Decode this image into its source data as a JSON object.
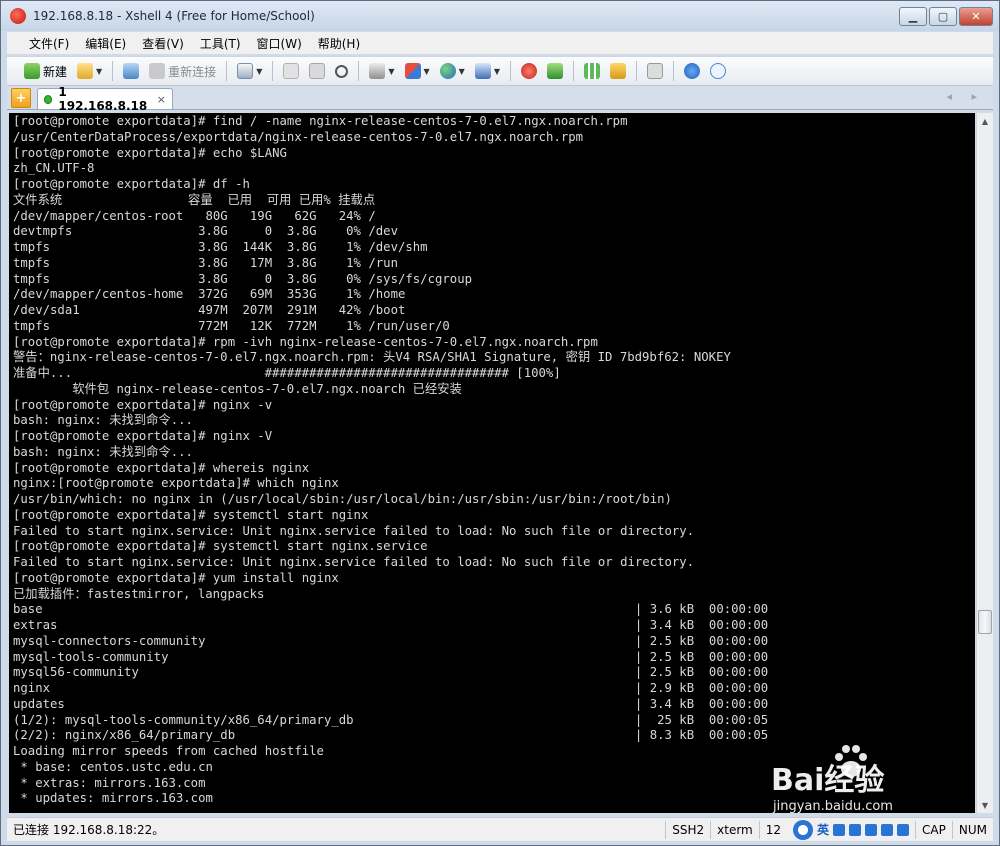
{
  "window": {
    "title": "192.168.8.18 - Xshell 4 (Free for Home/School)"
  },
  "window_controls": {
    "minimize": "▁",
    "maximize": "▢",
    "close": "✕"
  },
  "menu": [
    "文件(F)",
    "编辑(E)",
    "查看(V)",
    "工具(T)",
    "窗口(W)",
    "帮助(H)"
  ],
  "toolbar": {
    "new_label": "新建",
    "reconnect_label": "重新连接"
  },
  "tab": {
    "label": "1 192.168.8.18",
    "close": "×",
    "nav": "◂ ▸"
  },
  "colors": {
    "terminal_bg": "#000000",
    "terminal_fg": "#d8d8d8",
    "tab_dot": "#2fb52f"
  },
  "terminal": {
    "lines": [
      "[root@promote exportdata]# find / -name nginx-release-centos-7-0.el7.ngx.noarch.rpm",
      "/usr/CenterDataProcess/exportdata/nginx-release-centos-7-0.el7.ngx.noarch.rpm",
      "[root@promote exportdata]# echo $LANG",
      "zh_CN.UTF-8",
      "[root@promote exportdata]# df -h",
      "文件系统                 容量  已用  可用 已用% 挂载点",
      "/dev/mapper/centos-root   80G   19G   62G   24% /",
      "devtmpfs                 3.8G     0  3.8G    0% /dev",
      "tmpfs                    3.8G  144K  3.8G    1% /dev/shm",
      "tmpfs                    3.8G   17M  3.8G    1% /run",
      "tmpfs                    3.8G     0  3.8G    0% /sys/fs/cgroup",
      "/dev/mapper/centos-home  372G   69M  353G    1% /home",
      "/dev/sda1                497M  207M  291M   42% /boot",
      "tmpfs                    772M   12K  772M    1% /run/user/0",
      "[root@promote exportdata]# rpm -ivh nginx-release-centos-7-0.el7.ngx.noarch.rpm",
      "警告：nginx-release-centos-7-0.el7.ngx.noarch.rpm: 头V4 RSA/SHA1 Signature, 密钥 ID 7bd9bf62: NOKEY",
      "准备中...                          ################################# [100%]",
      "        软件包 nginx-release-centos-7-0.el7.ngx.noarch 已经安装",
      "[root@promote exportdata]# nginx -v",
      "bash: nginx: 未找到命令...",
      "[root@promote exportdata]# nginx -V",
      "bash: nginx: 未找到命令...",
      "[root@promote exportdata]# whereis nginx",
      "nginx:[root@promote exportdata]# which nginx",
      "/usr/bin/which: no nginx in (/usr/local/sbin:/usr/local/bin:/usr/sbin:/usr/bin:/root/bin)",
      "[root@promote exportdata]# systemctl start nginx",
      "Failed to start nginx.service: Unit nginx.service failed to load: No such file or directory.",
      "[root@promote exportdata]# systemctl start nginx.service",
      "Failed to start nginx.service: Unit nginx.service failed to load: No such file or directory.",
      "[root@promote exportdata]# yum install nginx",
      "已加载插件：fastestmirror, langpacks",
      "base                                                                                | 3.6 kB  00:00:00",
      "extras                                                                              | 3.4 kB  00:00:00",
      "mysql-connectors-community                                                          | 2.5 kB  00:00:00",
      "mysql-tools-community                                                               | 2.5 kB  00:00:00",
      "mysql56-community                                                                   | 2.5 kB  00:00:00",
      "nginx                                                                               | 2.9 kB  00:00:00",
      "updates                                                                             | 3.4 kB  00:00:00",
      "(1/2): mysql-tools-community/x86_64/primary_db                                      |  25 kB  00:00:05",
      "(2/2): nginx/x86_64/primary_db                                                      | 8.3 kB  00:00:05",
      "Loading mirror speeds from cached hostfile",
      " * base: centos.ustc.edu.cn",
      " * extras: mirrors.163.com",
      " * updates: mirrors.163.com"
    ]
  },
  "statusbar": {
    "connection": "已连接 192.168.8.18:22。",
    "protocol": "SSH2",
    "terminal_type": "xterm",
    "size": "12",
    "ime_lang": "英",
    "cap": "CAP",
    "num": "NUM"
  },
  "watermark": {
    "brand": "Bai经验",
    "url": "jingyan.baidu.com"
  }
}
